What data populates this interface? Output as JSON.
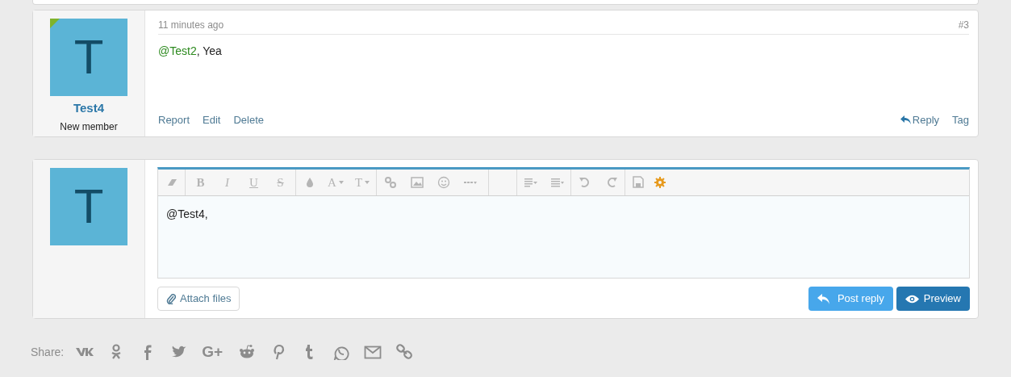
{
  "post": {
    "avatar_letter": "T",
    "online": true,
    "username": "Test4",
    "user_title": "New member",
    "time": "11 minutes ago",
    "number": "#3",
    "mention": "@Test2",
    "message": ", Yea",
    "actions": [
      "Report",
      "Edit",
      "Delete"
    ],
    "right_actions": [
      {
        "label": "Reply",
        "kind": "reply"
      },
      {
        "label": "Tag",
        "kind": "plain"
      }
    ]
  },
  "editor": {
    "avatar_letter": "T",
    "toolbar_glyphs": [
      "B",
      "I",
      "U",
      "S",
      "A",
      "T"
    ],
    "value": "@Test4,",
    "attach": "Attach files",
    "post_reply": "Post reply",
    "preview": "Preview"
  },
  "share": {
    "label": "Share:",
    "gplus": "G+"
  }
}
